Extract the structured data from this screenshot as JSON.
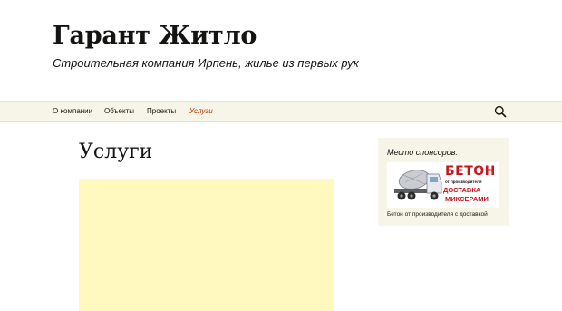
{
  "header": {
    "site_title": "Гарант Житло",
    "site_description": "Строительная компания Ирпень, жилье из первых рук"
  },
  "nav": {
    "items": [
      {
        "label": "О компании"
      },
      {
        "label": "Объекты"
      },
      {
        "label": "Проекты"
      },
      {
        "label": "Услуги"
      }
    ],
    "search_icon": "search-icon"
  },
  "main": {
    "page_title": "Услуги"
  },
  "sidebar": {
    "widget_title": "Место спонсоров:",
    "ad": {
      "word_1": "БЕТОН",
      "word_2": "от производителя",
      "word_3": "ДОСТАВКА",
      "word_4": "МИКСЕРАМИ",
      "caption": "Бетон от производителя с доставкой"
    }
  },
  "colors": {
    "accent": "#bc360a",
    "nav_background": "#f7f5e7",
    "content_highlight": "#fff9c0",
    "ad_red": "#c8161d"
  }
}
